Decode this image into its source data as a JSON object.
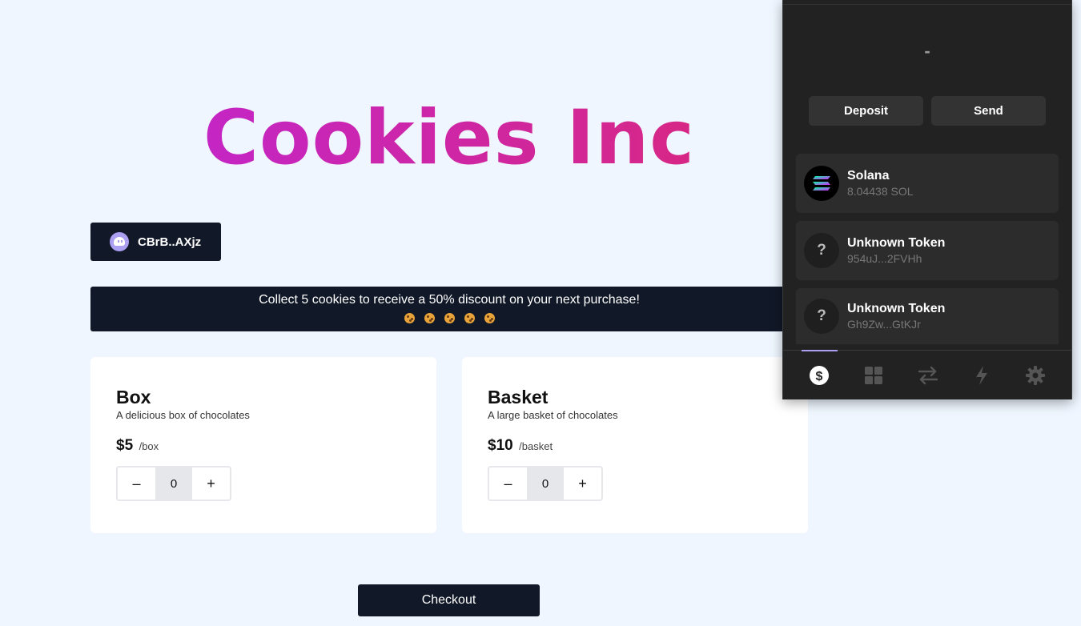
{
  "store": {
    "title": "Cookies Inc",
    "wallet_address": "CBrB..AXjz",
    "promo_text": "Collect 5 cookies to receive a 50% discount on your next purchase!",
    "promo_cookie_count": 5,
    "products": [
      {
        "name": "Box",
        "description": "A delicious box of chocolates",
        "price": "$5",
        "unit": "/box",
        "quantity": "0",
        "minus": "–",
        "plus": "+"
      },
      {
        "name": "Basket",
        "description": "A large basket of chocolates",
        "price": "$10",
        "unit": "/basket",
        "quantity": "0",
        "minus": "–",
        "plus": "+"
      }
    ],
    "checkout_label": "Checkout"
  },
  "wallet": {
    "balance": "-",
    "actions": {
      "deposit": "Deposit",
      "send": "Send"
    },
    "tokens": [
      {
        "name": "Solana",
        "detail": "8.04438 SOL",
        "icon": "solana-icon"
      },
      {
        "name": "Unknown Token",
        "detail": "954uJ...2FVHh",
        "icon": "question-icon",
        "glyph": "?"
      },
      {
        "name": "Unknown Token",
        "detail": "Gh9Zw...GtKJr",
        "icon": "question-icon",
        "glyph": "?"
      }
    ],
    "nav": [
      "dollar-icon",
      "grid-icon",
      "swap-icon",
      "bolt-icon",
      "gear-icon"
    ],
    "active_nav": "dollar-icon",
    "accent_color": "#ab9ff2"
  },
  "colors": {
    "background": "#eff6ff",
    "dark": "#111827",
    "title_gradient_start": "#c026d3",
    "title_gradient_end": "#db2777"
  }
}
